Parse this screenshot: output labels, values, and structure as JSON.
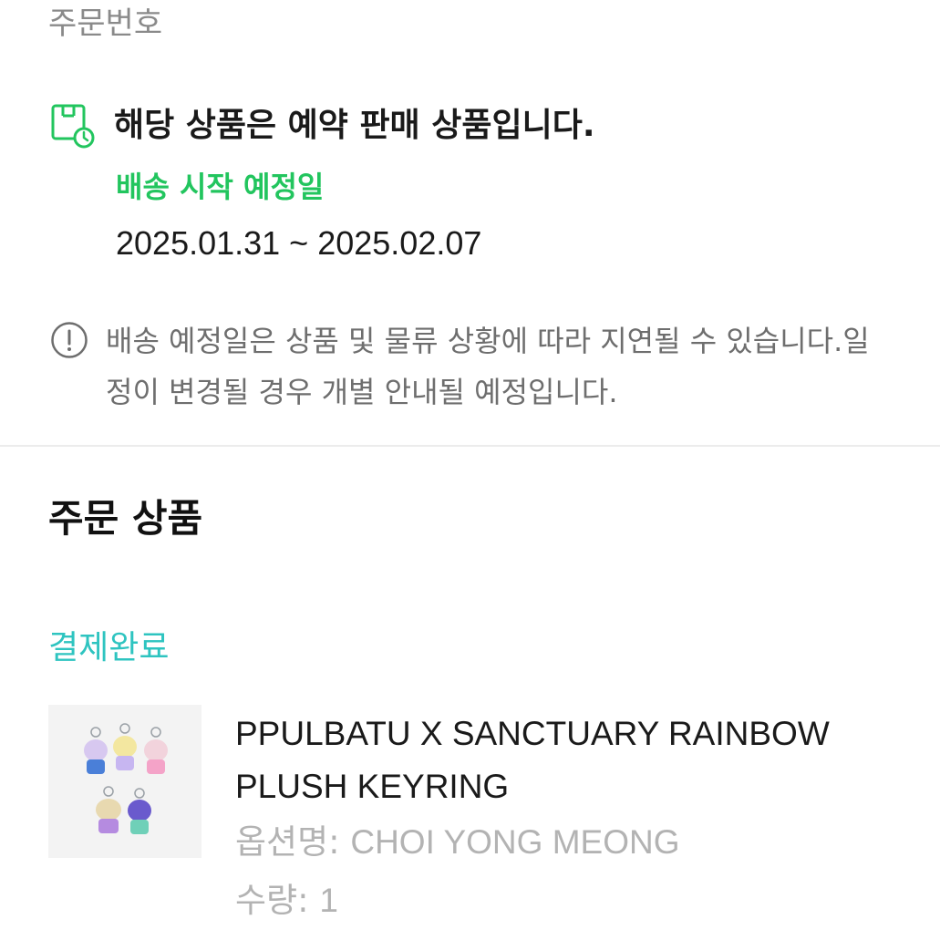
{
  "order": {
    "number_label": "주문번호"
  },
  "preorder_notice": {
    "title": "해당 상품은 예약 판매 상품입니다.",
    "ship_label": "배송 시작 예정일",
    "ship_dates": "2025.01.31 ~ 2025.02.07",
    "info_text": "배송 예정일은 상품 및 물류 상황에 따라 지연될 수 있습니다.일정이 변경될 경우 개별 안내될 예정입니다.",
    "icon": "calendar-clock-icon",
    "info_icon": "exclamation-circle-icon"
  },
  "order_items": {
    "title": "주문 상품",
    "status": "결제완료",
    "item": {
      "name": "PPULBATU X SANCTUARY RAINBOW PLUSH KEYRING",
      "option_label": "옵션명: ",
      "option_value": "CHOI YONG MEONG",
      "qty_label": "수량: ",
      "qty_value": "1"
    }
  },
  "colors": {
    "accent_green": "#22c55e",
    "status_teal": "#2ec4c0",
    "muted_text": "#6e6e6e"
  }
}
